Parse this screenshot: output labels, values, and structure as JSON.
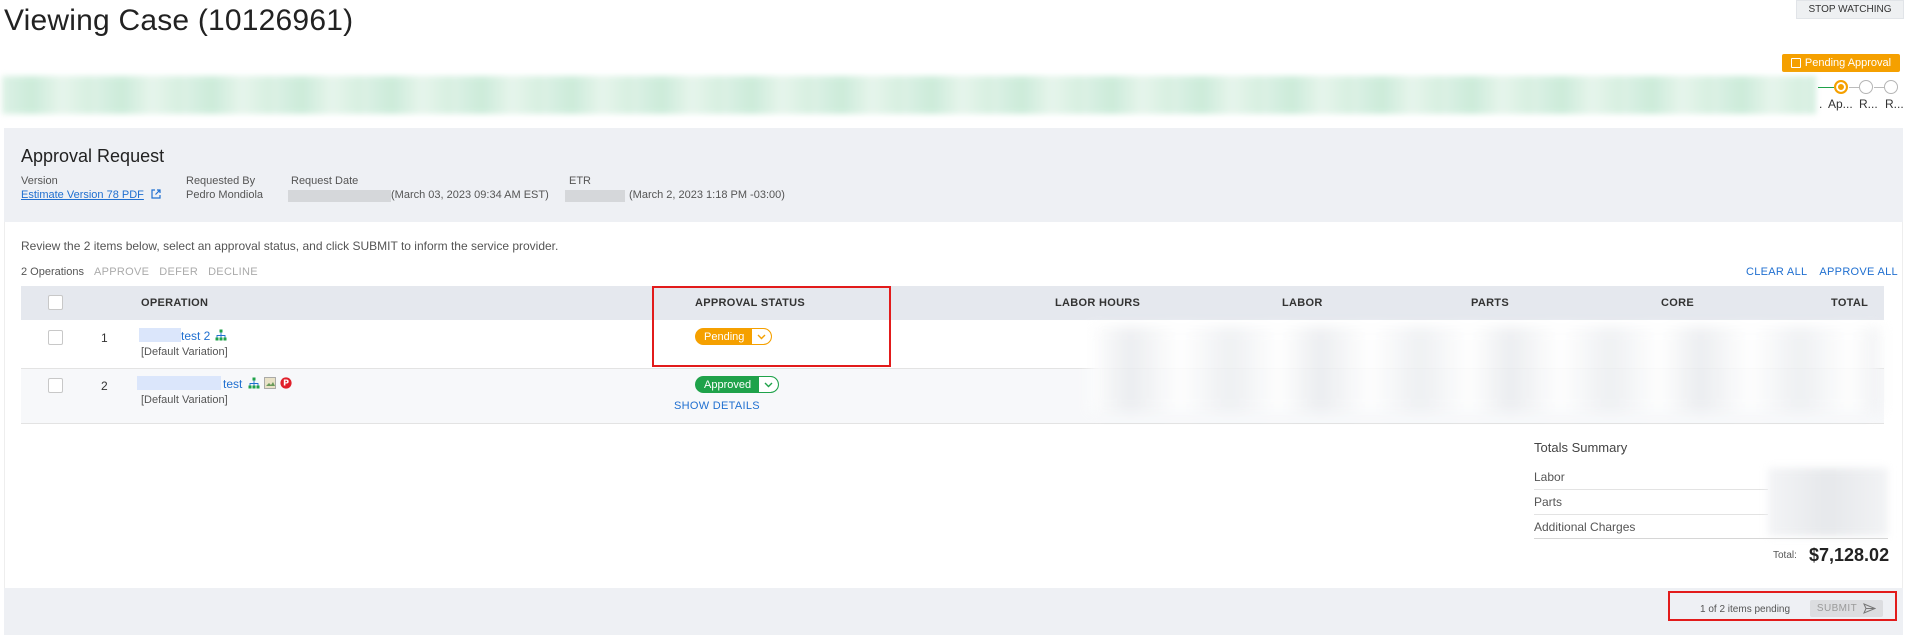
{
  "page": {
    "title": "Viewing Case (10126961)",
    "stop_watching": "STOP WATCHING"
  },
  "status": {
    "label": "Pending Approval",
    "color": "#f5a000"
  },
  "stepper": {
    "labels": [
      ".",
      "Ap...",
      "R...",
      "R..."
    ]
  },
  "approval": {
    "title": "Approval Request",
    "version_label": "Version",
    "version_link": "Estimate Version 78 PDF",
    "requested_by_label": "Requested By",
    "requested_by": "Pedro Mondiola",
    "request_date_label": "Request Date",
    "request_date": "(March 03, 2023 09:34 AM EST)",
    "etr_label": "ETR",
    "etr": "(March 2, 2023 1:18 PM -03:00)"
  },
  "instructions": "Review the 2 items below, select an approval status, and click SUBMIT to inform the service provider.",
  "ops_bar": {
    "count": "2 Operations",
    "approve": "APPROVE",
    "defer": "DEFER",
    "decline": "DECLINE",
    "clear_all": "CLEAR ALL",
    "approve_all": "APPROVE ALL"
  },
  "table": {
    "headers": {
      "operation": "OPERATION",
      "approval_status": "APPROVAL STATUS",
      "labor_hours": "LABOR HOURS",
      "labor": "LABOR",
      "parts": "PARTS",
      "core": "CORE",
      "total": "TOTAL"
    },
    "rows": [
      {
        "num": "1",
        "name": "test 2",
        "variation": "[Default Variation]",
        "status": "Pending"
      },
      {
        "num": "2",
        "name": "test",
        "variation": "[Default Variation]",
        "status": "Approved",
        "show_details": "SHOW DETAILS"
      }
    ]
  },
  "totals": {
    "title": "Totals Summary",
    "labor": "Labor",
    "parts": "Parts",
    "additional": "Additional Charges",
    "total_label": "Total:",
    "total_value": "$7,128.02"
  },
  "footer": {
    "pending_text": "1 of 2 items pending",
    "submit": "SUBMIT"
  },
  "colors": {
    "highlight": "#e21b1b",
    "pending": "#f5a000",
    "approved": "#1fa24a",
    "link": "#1f6fd0"
  }
}
